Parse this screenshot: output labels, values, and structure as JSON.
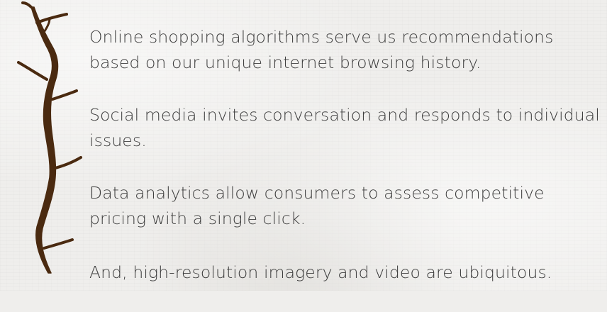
{
  "decoration": {
    "branch_icon": "tree-branch",
    "branch_color": "#4a2a10"
  },
  "paragraphs": [
    "Online shopping algorithms serve us recommendations based on our unique internet browsing history.",
    "Social media invites conversation and responds to individual issues.",
    "Data analytics allow consumers to assess competitive pricing with a single click.",
    "And, high-resolution imagery and video are ubiquitous."
  ]
}
